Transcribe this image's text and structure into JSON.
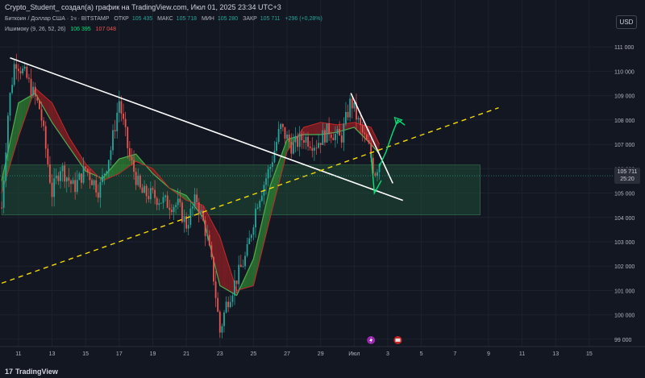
{
  "header": {
    "title": "Crypto_Student_ создал(а) график на TradingView.com, Июл 01, 2025 23:34 UTC+3",
    "ohlc": {
      "symbol": "Биткоин / Доллар США · 1ч · BITSTAMP",
      "open_label": "ОТКР",
      "open_value": "105 435",
      "high_label": "МАКС",
      "high_value": "105 718",
      "low_label": "МИН",
      "low_value": "105 280",
      "close_label": "ЗАКР",
      "close_value": "105 711",
      "change": "+296 (+0,28%)"
    },
    "indicator": {
      "name": "Ишимоку (9, 26, 52, 26)",
      "value_a": "106 395",
      "value_b": "107 048"
    },
    "currency": "USD"
  },
  "price_tag": {
    "price": "105 711",
    "countdown": "25:20"
  },
  "footer": {
    "logo_text": "TradingView",
    "logo_mark": "17"
  },
  "colors": {
    "background": "#131722",
    "up": "#26a69a",
    "down": "#ef5350",
    "cloud_bull": "#2e7d32",
    "cloud_bear": "#8b1e24",
    "trendline": "#ffffff",
    "support_line": "#f5d90a",
    "zone": "#1f4d35",
    "annotation": "#00e676"
  },
  "chart_data": {
    "type": "candlestick",
    "symbol": "BTCUSD",
    "timeframe": "1h",
    "ylim": [
      98700,
      111600
    ],
    "y_ticks": [
      99000,
      100000,
      101000,
      102000,
      103000,
      104000,
      105000,
      106000,
      107000,
      108000,
      109000,
      110000,
      111000
    ],
    "y_tick_labels": [
      "99 000",
      "100 000",
      "101 000",
      "102 000",
      "103 000",
      "104 000",
      "105 000",
      "106 000",
      "107 000",
      "108 000",
      "109 000",
      "110 000",
      "111 000"
    ],
    "x_tick_labels": [
      "11",
      "13",
      "15",
      "17",
      "19",
      "21",
      "23",
      "25",
      "27",
      "29",
      "Июл",
      "3",
      "5",
      "7",
      "9",
      "11",
      "13",
      "15"
    ],
    "x_ticks_day": [
      11,
      13,
      15,
      17,
      19,
      21,
      23,
      25,
      27,
      29,
      31,
      33,
      35,
      37,
      39,
      41,
      43,
      45
    ],
    "xlim_day": [
      9.9,
      46.4
    ],
    "close_path": [
      {
        "day": 10.0,
        "price": 104400
      },
      {
        "day": 10.4,
        "price": 108500
      },
      {
        "day": 10.8,
        "price": 110500
      },
      {
        "day": 11.5,
        "price": 109700
      },
      {
        "day": 12.3,
        "price": 108400
      },
      {
        "day": 13.0,
        "price": 105000
      },
      {
        "day": 13.5,
        "price": 106100
      },
      {
        "day": 14.3,
        "price": 105200
      },
      {
        "day": 15.0,
        "price": 106000
      },
      {
        "day": 15.8,
        "price": 105100
      },
      {
        "day": 16.5,
        "price": 106800
      },
      {
        "day": 17.0,
        "price": 108800
      },
      {
        "day": 17.6,
        "price": 106500
      },
      {
        "day": 18.3,
        "price": 105000
      },
      {
        "day": 19.0,
        "price": 104900
      },
      {
        "day": 19.8,
        "price": 104600
      },
      {
        "day": 20.5,
        "price": 104500
      },
      {
        "day": 21.0,
        "price": 103700
      },
      {
        "day": 21.6,
        "price": 104800
      },
      {
        "day": 22.2,
        "price": 103300
      },
      {
        "day": 22.6,
        "price": 101700
      },
      {
        "day": 23.0,
        "price": 99300
      },
      {
        "day": 23.4,
        "price": 100500
      },
      {
        "day": 24.0,
        "price": 101500
      },
      {
        "day": 24.6,
        "price": 102500
      },
      {
        "day": 25.2,
        "price": 104600
      },
      {
        "day": 26.0,
        "price": 106100
      },
      {
        "day": 26.6,
        "price": 107700
      },
      {
        "day": 27.3,
        "price": 106900
      },
      {
        "day": 28.0,
        "price": 107300
      },
      {
        "day": 28.7,
        "price": 107000
      },
      {
        "day": 29.5,
        "price": 107600
      },
      {
        "day": 30.2,
        "price": 107200
      },
      {
        "day": 30.8,
        "price": 108800
      },
      {
        "day": 31.4,
        "price": 107600
      },
      {
        "day": 31.9,
        "price": 106800
      },
      {
        "day": 32.2,
        "price": 105800
      },
      {
        "day": 32.5,
        "price": 106300
      }
    ],
    "ichimoku": {
      "conversion": [
        {
          "day": 10.0,
          "price": 105500
        },
        {
          "day": 11.0,
          "price": 108700
        },
        {
          "day": 12.0,
          "price": 109100
        },
        {
          "day": 13.0,
          "price": 107900
        },
        {
          "day": 14.0,
          "price": 106900
        },
        {
          "day": 15.0,
          "price": 105900
        },
        {
          "day": 16.0,
          "price": 105600
        },
        {
          "day": 17.0,
          "price": 106400
        },
        {
          "day": 18.0,
          "price": 106600
        },
        {
          "day": 19.0,
          "price": 105800
        },
        {
          "day": 20.0,
          "price": 105200
        },
        {
          "day": 21.0,
          "price": 104900
        },
        {
          "day": 22.0,
          "price": 104000
        },
        {
          "day": 23.0,
          "price": 101200
        },
        {
          "day": 24.0,
          "price": 100800
        },
        {
          "day": 25.0,
          "price": 102300
        },
        {
          "day": 26.0,
          "price": 105300
        },
        {
          "day": 27.0,
          "price": 107200
        },
        {
          "day": 28.0,
          "price": 107400
        },
        {
          "day": 29.0,
          "price": 107400
        },
        {
          "day": 30.0,
          "price": 107500
        },
        {
          "day": 31.0,
          "price": 107700
        },
        {
          "day": 32.0,
          "price": 107000
        },
        {
          "day": 32.5,
          "price": 106600
        }
      ],
      "base": [
        {
          "day": 10.0,
          "price": 105000
        },
        {
          "day": 11.0,
          "price": 107300
        },
        {
          "day": 12.0,
          "price": 109300
        },
        {
          "day": 13.0,
          "price": 108700
        },
        {
          "day": 14.0,
          "price": 107300
        },
        {
          "day": 15.0,
          "price": 106200
        },
        {
          "day": 16.0,
          "price": 105500
        },
        {
          "day": 17.0,
          "price": 105800
        },
        {
          "day": 18.0,
          "price": 106300
        },
        {
          "day": 19.0,
          "price": 106000
        },
        {
          "day": 20.0,
          "price": 105200
        },
        {
          "day": 21.0,
          "price": 104700
        },
        {
          "day": 22.0,
          "price": 104500
        },
        {
          "day": 23.0,
          "price": 103200
        },
        {
          "day": 24.0,
          "price": 101000
        },
        {
          "day": 25.0,
          "price": 101200
        },
        {
          "day": 26.0,
          "price": 104000
        },
        {
          "day": 27.0,
          "price": 106700
        },
        {
          "day": 28.0,
          "price": 107700
        },
        {
          "day": 29.0,
          "price": 107900
        },
        {
          "day": 30.0,
          "price": 107800
        },
        {
          "day": 31.0,
          "price": 107900
        },
        {
          "day": 32.0,
          "price": 107700
        },
        {
          "day": 32.5,
          "price": 107000
        }
      ]
    },
    "trendlines": [
      {
        "kind": "resistance",
        "color": "#ffffff",
        "from": {
          "day": 10.5,
          "price": 110550
        },
        "to": {
          "day": 33.9,
          "price": 104700
        }
      },
      {
        "kind": "resistance-short",
        "color": "#ffffff",
        "from": {
          "day": 30.8,
          "price": 109100
        },
        "to": {
          "day": 33.3,
          "price": 105400
        }
      },
      {
        "kind": "support-dashed",
        "color": "#f5d90a",
        "from": {
          "day": 10.0,
          "price": 101300
        },
        "to": {
          "day": 39.6,
          "price": 108500
        }
      }
    ],
    "zone": {
      "from_day": 10.0,
      "to_day": 38.5,
      "top": 106150,
      "bottom": 104100
    },
    "annotation_path": [
      {
        "day": 32.5,
        "price": 106100
      },
      {
        "day": 32.9,
        "price": 106700
      },
      {
        "day": 33.3,
        "price": 107500
      },
      {
        "day": 33.6,
        "price": 108000
      },
      {
        "day": 34.0,
        "price": 107800
      }
    ],
    "annotation_check": [
      {
        "day": 32.0,
        "price": 106600
      },
      {
        "day": 32.2,
        "price": 105000
      },
      {
        "day": 32.6,
        "price": 105500
      }
    ],
    "last_price": 105711
  }
}
